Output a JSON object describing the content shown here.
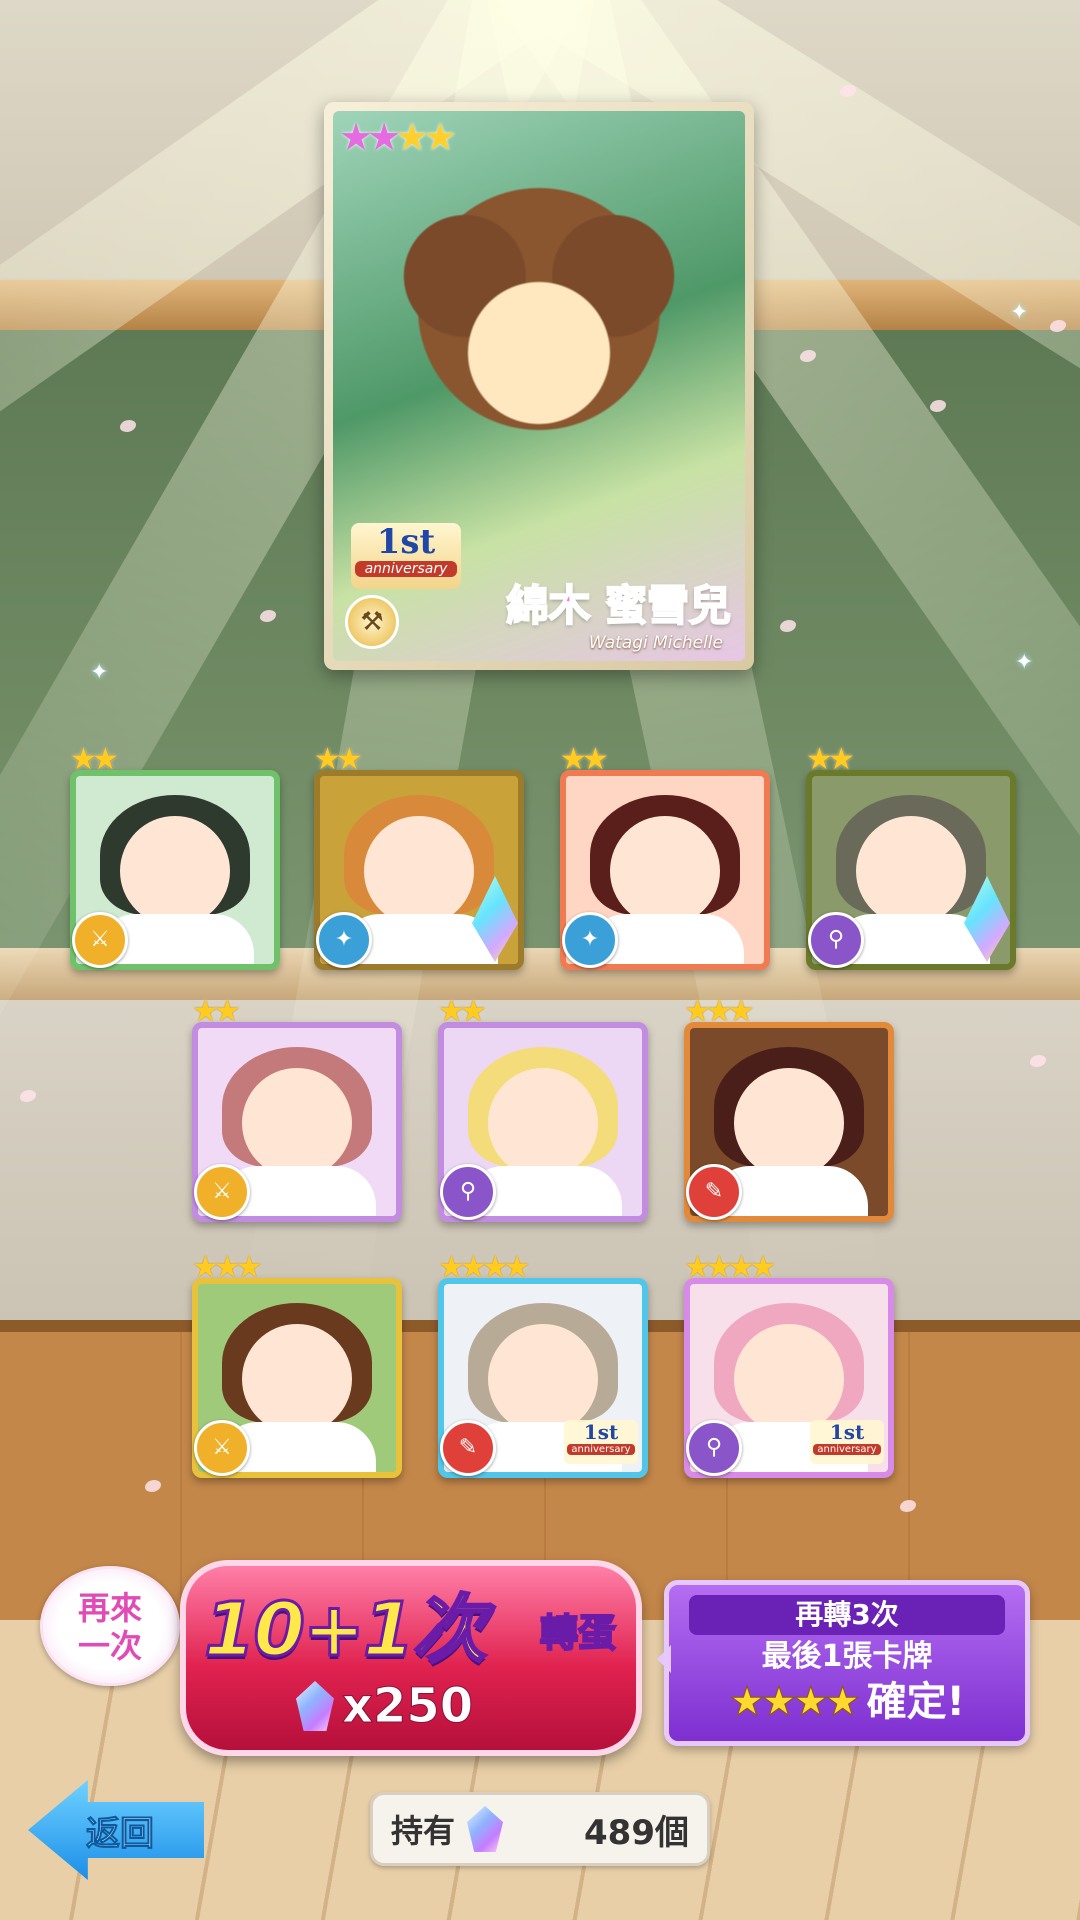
{
  "featured_card": {
    "rarity_stars": 4,
    "name": "綿木 蜜雪兒",
    "name_romaji": "Watagi Michelle",
    "badge_main": "1st",
    "badge_sub": "anniversary",
    "type_icon": "hammer-icon"
  },
  "result_cards": [
    {
      "stars": "★★",
      "frame": "#6fc16a",
      "icon": "sword-icon",
      "icon_color": "#f0b02a",
      "hair": "#2f3a2f",
      "bg": "#cfead1"
    },
    {
      "stars": "★★",
      "frame": "#9c7b2a",
      "icon": "gun-icon",
      "icon_color": "#3ba0d8",
      "hair": "#d88a3a",
      "bg": "#c9a23a",
      "crystal": true
    },
    {
      "stars": "★★",
      "frame": "#f07a52",
      "icon": "gun-icon",
      "icon_color": "#3ba0d8",
      "hair": "#5a1f1a",
      "bg": "#ffd6c4"
    },
    {
      "stars": "★★",
      "frame": "#6a7a2a",
      "icon": "staff-icon",
      "icon_color": "#8a55c8",
      "hair": "#6a6a5a",
      "bg": "#8a9a6a",
      "crystal": true
    },
    {
      "stars": "★★",
      "frame": "#c28ce0",
      "icon": "sword-icon",
      "icon_color": "#f0b02a",
      "hair": "#c47a7a",
      "bg": "#f1daf6"
    },
    {
      "stars": "★★",
      "frame": "#c28ce0",
      "icon": "staff-icon",
      "icon_color": "#8a55c8",
      "hair": "#f5dc7a",
      "bg": "#ecd8f4"
    },
    {
      "stars": "★★★",
      "frame": "#e38a3a",
      "icon": "blade-icon",
      "icon_color": "#e0403a",
      "hair": "#4a1f1a",
      "bg": "#7a4a2a"
    },
    {
      "stars": "★★★",
      "frame": "#e7c23a",
      "icon": "sword-icon",
      "icon_color": "#f0b02a",
      "hair": "#6a3a1f",
      "bg": "#9fca7a"
    },
    {
      "stars": "★★★★",
      "frame": "#4fc6ea",
      "icon": "blade-icon",
      "icon_color": "#e0403a",
      "hair": "#b7ab98",
      "bg": "#eef2f6",
      "anniversary": true
    },
    {
      "stars": "★★★★",
      "frame": "#d78ae8",
      "icon": "staff-icon",
      "icon_color": "#8a55c8",
      "hair": "#f0a8c0",
      "bg": "#f7e0ea",
      "anniversary": true
    }
  ],
  "anniversary_badge": {
    "main": "1st",
    "sub": "anniversary"
  },
  "again": {
    "line1": "再來",
    "line2": "一次"
  },
  "gacha_button": {
    "main": "10+1次",
    "sub": "轉蛋",
    "cost_prefix": "x",
    "cost": "250"
  },
  "bonus_panel": {
    "line1": "再轉3次",
    "line2": "最後1張卡牌",
    "stars": "★★★★",
    "confirm": "確定!"
  },
  "back_button": {
    "label": "返回"
  },
  "owned": {
    "label": "持有",
    "value": "489個"
  }
}
